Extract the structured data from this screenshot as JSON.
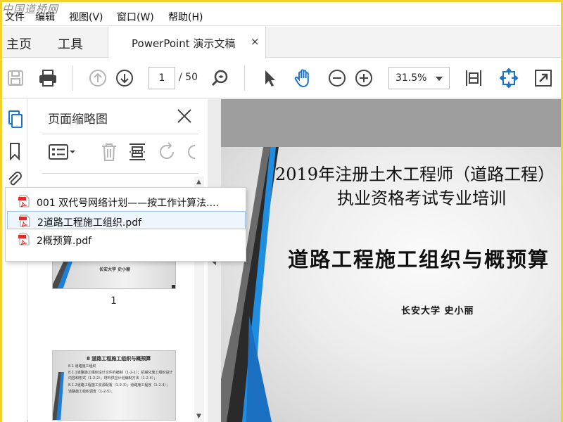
{
  "watermark": "中国道桥网",
  "menubar": {
    "items": [
      "文件",
      "编辑",
      "视图(V)",
      "窗口(W)",
      "帮助(H)"
    ]
  },
  "tabs": {
    "home": "主页",
    "tools": "工具",
    "document": "PowerPoint 演示文稿",
    "close": "×"
  },
  "toolbar": {
    "page_current": "1",
    "page_total": "/ 50",
    "zoom": "31.5%"
  },
  "panel": {
    "title": "页面缩略图",
    "thumbnails": [
      {
        "page_label": "1",
        "text": "长安大学 史小丽"
      },
      {
        "title": "8 道路工程施工组织与概预算",
        "lines": [
          "8.1 道路施工组织",
          "8.1.1道路施工组织设计文件的编制（1-2-1）；机械化施工组织设计",
          "内容和形式（1-2-2）；材料供应计划编制方法（1-2-4）；",
          "8.1.2道路工程施工资源配置（1-2-3）；道路施工程序（1-2-4）；",
          "道路施工组织调查（1-2-5）。"
        ]
      }
    ]
  },
  "slide": {
    "title_line1": "2019年注册土木工程师（道路工程）",
    "title_line2": "执业资格考试专业培训",
    "subtitle": "道路工程施工组织与概预算",
    "author": "长安大学  史小丽"
  },
  "dropdown": {
    "items": [
      {
        "label": "001  双代号网络计划——按工作计算法....",
        "selected": false
      },
      {
        "label": "2道路工程施工组织.pdf",
        "selected": true
      },
      {
        "label": "2概预算.pdf",
        "selected": false
      }
    ]
  },
  "colors": {
    "accent": "#1a73c8",
    "hand_tool": "#1a73c8",
    "pdf_red": "#d9302c",
    "border_highlight": "#f2d22e"
  }
}
